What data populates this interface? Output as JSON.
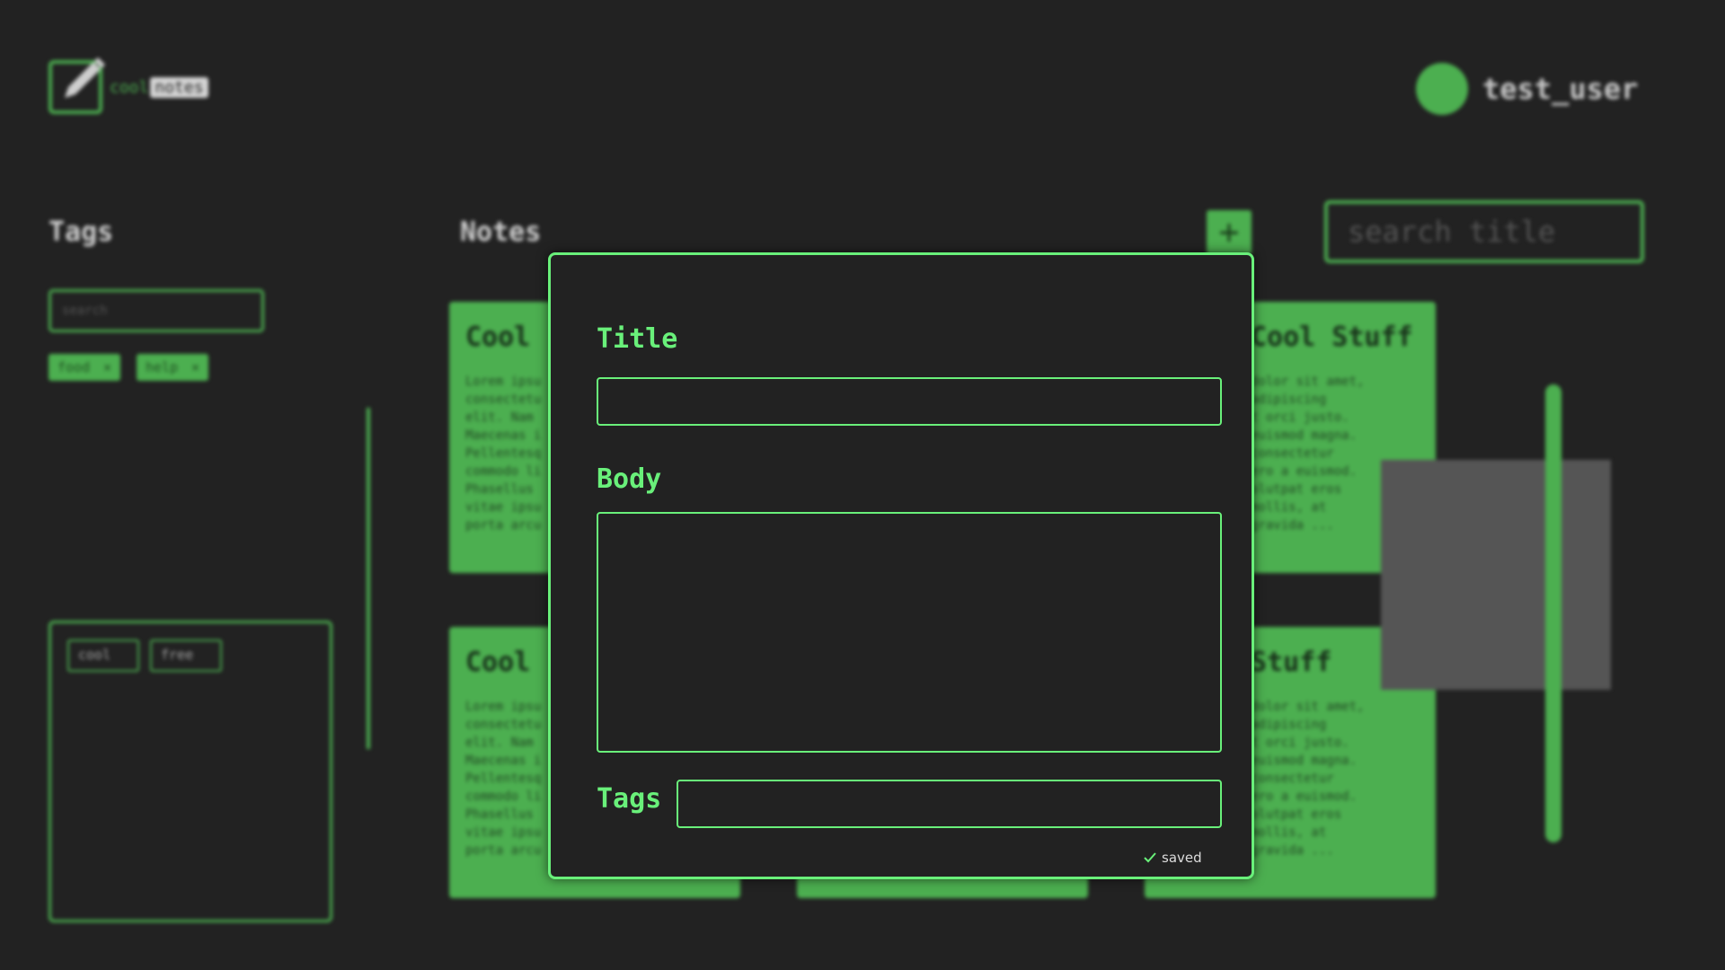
{
  "app": {
    "logo_word1": "cool",
    "logo_word2": "notes"
  },
  "user": {
    "name": "test_user"
  },
  "tags_panel": {
    "heading": "Tags",
    "search_placeholder": "search",
    "tags": [
      {
        "label": "food",
        "remove": "×"
      },
      {
        "label": "help",
        "remove": "×"
      }
    ],
    "selected": [
      {
        "label": "cool"
      },
      {
        "label": "free"
      }
    ]
  },
  "notes_panel": {
    "heading": "Notes",
    "add_label": "+",
    "search_placeholder": "search title",
    "cards": [
      {
        "title": "Cool",
        "body": "Lorem ipsu\nconsectetu\nelit. Nam\nMaecenas i\nPellentesq\ncommodo li\nPhasellus\nvitae ipsu\nporta arcu"
      },
      {
        "title": "Cool Stuff",
        "body": "dolor sit amet,\nadipiscing\nt orci justo.\neuismod magna.\nconsectetur\nero a euismod.\nolutpat eros\nmollis, at\ngravida ..."
      },
      {
        "title": "Cool",
        "body": "Lorem ipsu\nconsectetu\nelit. Nam\nMaecenas i\nPellentesq\ncommodo li\nPhasellus\nvitae ipsu\nporta arcu"
      },
      {
        "title": "Stuff",
        "body": "dolor sit amet,\nadipiscing\nt orci justo.\neuismod magna.\nconsectetur\nero a euismod.\nolutpat eros\nmollis, at\ngravida ..."
      }
    ]
  },
  "modal": {
    "title_label": "Title",
    "title_value": "",
    "body_label": "Body",
    "body_value": "",
    "tags_label": "Tags",
    "tags_value": "",
    "status": "saved"
  },
  "colors": {
    "accent": "#4caf50",
    "modal_accent": "#69f07a",
    "background": "#222222"
  },
  "icons": {
    "logo": "pencil-square-icon",
    "status": "check-icon"
  }
}
